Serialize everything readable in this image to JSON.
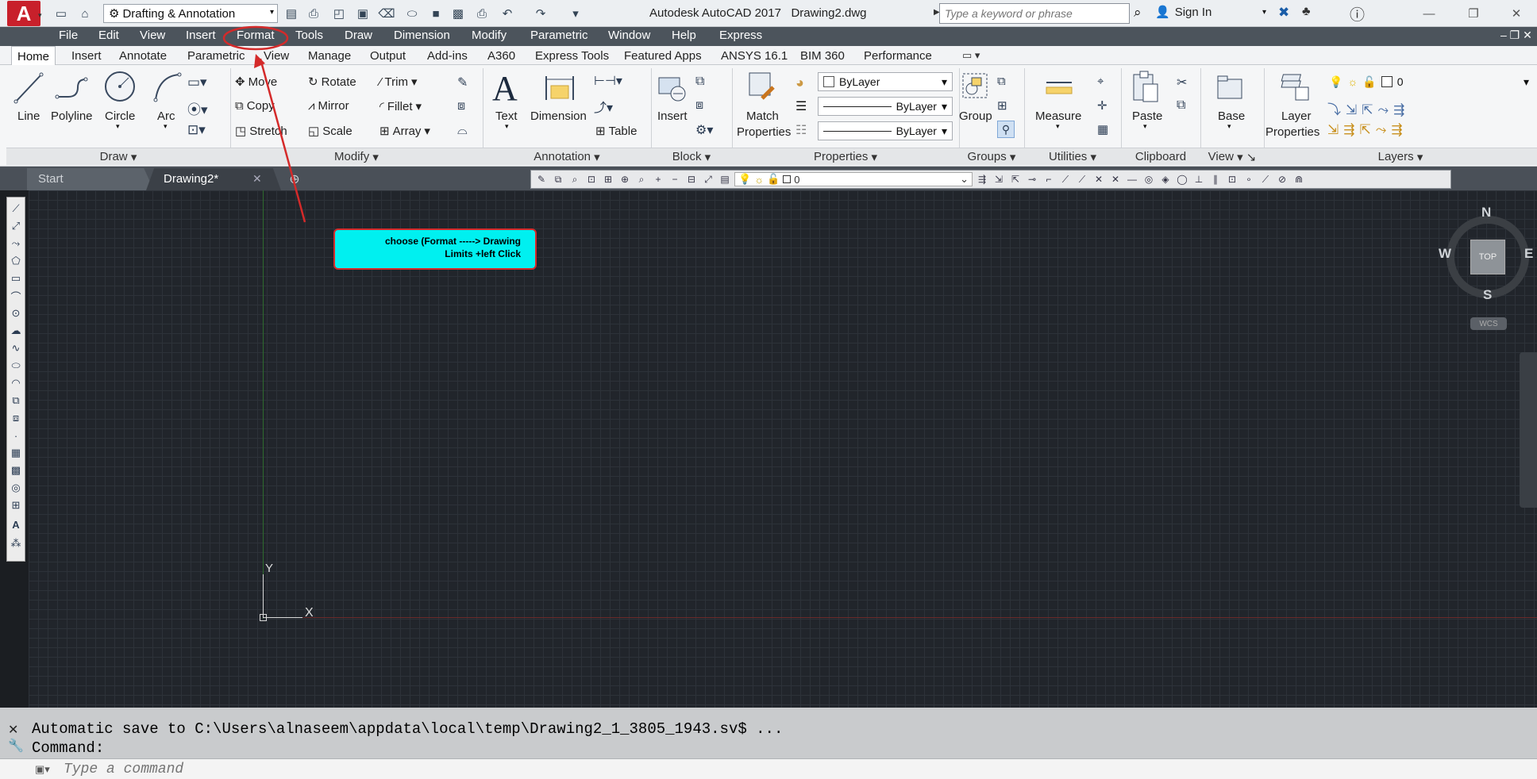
{
  "titlebar": {
    "workspace": "Drafting & Annotation",
    "app_name": "Autodesk AutoCAD 2017",
    "document": "Drawing2.dwg",
    "search_placeholder": "Type a keyword or phrase",
    "sign_in": "Sign In"
  },
  "menu": [
    "File",
    "Edit",
    "View",
    "Insert",
    "Format",
    "Tools",
    "Draw",
    "Dimension",
    "Modify",
    "Parametric",
    "Window",
    "Help",
    "Express"
  ],
  "ribbon_tabs": [
    "Home",
    "Insert",
    "Annotate",
    "Parametric",
    "View",
    "Manage",
    "Output",
    "Add-ins",
    "A360",
    "Express Tools",
    "Featured Apps",
    "ANSYS 16.1",
    "BIM 360",
    "Performance"
  ],
  "ribbon": {
    "draw": {
      "line": "Line",
      "polyline": "Polyline",
      "circle": "Circle",
      "arc": "Arc",
      "title": "Draw"
    },
    "modify": {
      "move": "Move",
      "copy": "Copy",
      "stretch": "Stretch",
      "rotate": "Rotate",
      "mirror": "Mirror",
      "scale": "Scale",
      "trim": "Trim",
      "fillet": "Fillet",
      "array": "Array",
      "title": "Modify"
    },
    "annotation": {
      "text": "Text",
      "dimension": "Dimension",
      "table": "Table",
      "title": "Annotation"
    },
    "block": {
      "insert": "Insert",
      "title": "Block"
    },
    "properties": {
      "match_line1": "Match",
      "match_line2": "Properties",
      "color": "ByLayer",
      "linetype": "ByLayer",
      "lineweight": "ByLayer",
      "title": "Properties"
    },
    "groups": {
      "group": "Group",
      "title": "Groups"
    },
    "utilities": {
      "measure": "Measure",
      "title": "Utilities"
    },
    "clipboard": {
      "paste": "Paste",
      "title": "Clipboard"
    },
    "view": {
      "base": "Base",
      "title": "View"
    },
    "layers": {
      "layer_line1": "Layer",
      "layer_line2": "Properties",
      "current_layer": "0",
      "title": "Layers"
    }
  },
  "file_tabs": {
    "start": "Start",
    "drawing": "Drawing2*",
    "layer_combo": "0"
  },
  "canvas": {
    "callout_line1": "choose (Format -----> Drawing",
    "callout_line2": "Limits +left Click",
    "ucs_y": "Y",
    "ucs_x": "X"
  },
  "viewcube": {
    "north": "N",
    "south": "S",
    "east": "E",
    "west": "W",
    "top": "TOP",
    "wcs": "WCS"
  },
  "command": {
    "history_line1": "Automatic save to C:\\Users\\alnaseem\\appdata\\local\\temp\\Drawing2_1_3805_1943.sv$ ...",
    "history_line2": "Command:",
    "input_placeholder": "Type a command"
  },
  "colors": {
    "app_red": "#c8202b",
    "callout_bg": "#00f0f0",
    "annotation_red": "#d42a2a",
    "canvas_bg": "#21252b"
  }
}
